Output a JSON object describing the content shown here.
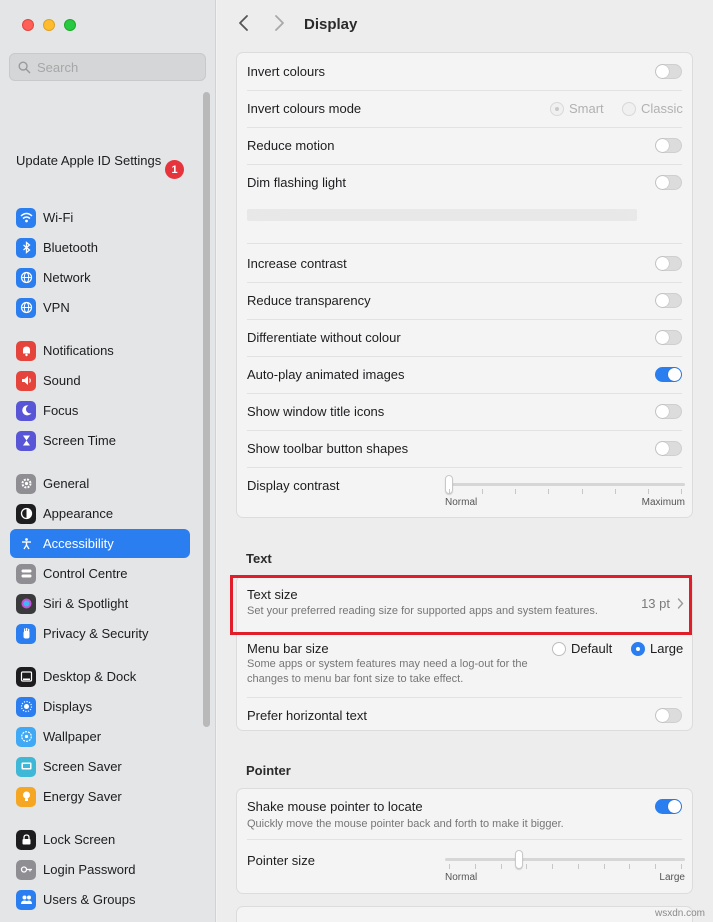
{
  "window": {
    "title": "Display"
  },
  "sidebar": {
    "search_placeholder": "Search",
    "apple_id": {
      "label": "Update Apple ID Settings",
      "badge": "1"
    },
    "items": [
      {
        "label": "Wi-Fi",
        "icon": "wifi-icon",
        "color": "#2a7ef0"
      },
      {
        "label": "Bluetooth",
        "icon": "bluetooth-icon",
        "color": "#2a7ef0"
      },
      {
        "label": "Network",
        "icon": "globe-icon",
        "color": "#2a7ef0"
      },
      {
        "label": "VPN",
        "icon": "vpn-globe-icon",
        "color": "#2a7ef0"
      },
      {
        "label": "Notifications",
        "icon": "bell-icon",
        "color": "#e5443c"
      },
      {
        "label": "Sound",
        "icon": "speaker-icon",
        "color": "#e5443c"
      },
      {
        "label": "Focus",
        "icon": "moon-icon",
        "color": "#5856d6"
      },
      {
        "label": "Screen Time",
        "icon": "hourglass-icon",
        "color": "#5856d6"
      },
      {
        "label": "General",
        "icon": "gear-icon",
        "color": "#8e8e93"
      },
      {
        "label": "Appearance",
        "icon": "appearance-icon",
        "color": "#1d1d1f"
      },
      {
        "label": "Accessibility",
        "icon": "accessibility-icon",
        "color": "#2a7ef0"
      },
      {
        "label": "Control Centre",
        "icon": "control-centre-icon",
        "color": "#8e8e93"
      },
      {
        "label": "Siri & Spotlight",
        "icon": "siri-icon",
        "color": "#3a3a3c"
      },
      {
        "label": "Privacy & Security",
        "icon": "hand-icon",
        "color": "#2a7ef0"
      },
      {
        "label": "Desktop & Dock",
        "icon": "dock-icon",
        "color": "#1d1d1f"
      },
      {
        "label": "Displays",
        "icon": "sun-icon",
        "color": "#2a7ef0"
      },
      {
        "label": "Wallpaper",
        "icon": "wallpaper-icon",
        "color": "#3fa9f5"
      },
      {
        "label": "Screen Saver",
        "icon": "screensaver-icon",
        "color": "#3fb8d8"
      },
      {
        "label": "Energy Saver",
        "icon": "bulb-icon",
        "color": "#f5a623"
      },
      {
        "label": "Lock Screen",
        "icon": "lock-icon",
        "color": "#1d1d1f"
      },
      {
        "label": "Login Password",
        "icon": "key-icon",
        "color": "#8e8e93"
      },
      {
        "label": "Users & Groups",
        "icon": "users-icon",
        "color": "#2a7ef0"
      }
    ]
  },
  "display_group": {
    "invert_colours": {
      "label": "Invert colours",
      "on": false
    },
    "invert_mode": {
      "label": "Invert colours mode",
      "options": [
        "Smart",
        "Classic"
      ],
      "selected": "Smart"
    },
    "reduce_motion": {
      "label": "Reduce motion",
      "on": false
    },
    "dim_flashing": {
      "label": "Dim flashing light",
      "on": false
    },
    "increase_contrast": {
      "label": "Increase contrast",
      "on": false
    },
    "reduce_transparency": {
      "label": "Reduce transparency",
      "on": false
    },
    "differentiate": {
      "label": "Differentiate without colour",
      "on": false
    },
    "autoplay": {
      "label": "Auto-play animated images",
      "on": true
    },
    "window_title_icons": {
      "label": "Show window title icons",
      "on": false
    },
    "toolbar_shapes": {
      "label": "Show toolbar button shapes",
      "on": false
    },
    "display_contrast": {
      "label": "Display contrast",
      "min_label": "Normal",
      "max_label": "Maximum",
      "level": 0
    }
  },
  "text_section": {
    "heading": "Text",
    "text_size": {
      "label": "Text size",
      "description": "Set your preferred reading size for supported apps and system features.",
      "value": "13 pt"
    },
    "menu_bar_size": {
      "label": "Menu bar size",
      "description": "Some apps or system features may need a log-out for the changes to menu bar font size to take effect.",
      "options": [
        "Default",
        "Large"
      ],
      "selected": "Large"
    },
    "prefer_horizontal": {
      "label": "Prefer horizontal text",
      "on": false
    }
  },
  "pointer_section": {
    "heading": "Pointer",
    "shake": {
      "label": "Shake mouse pointer to locate",
      "description": "Quickly move the mouse pointer back and forth to make it bigger.",
      "on": true
    },
    "pointer_size": {
      "label": "Pointer size",
      "min_label": "Normal",
      "max_label": "Large",
      "level": 0.3
    }
  },
  "watermark": "wsxdn.com"
}
